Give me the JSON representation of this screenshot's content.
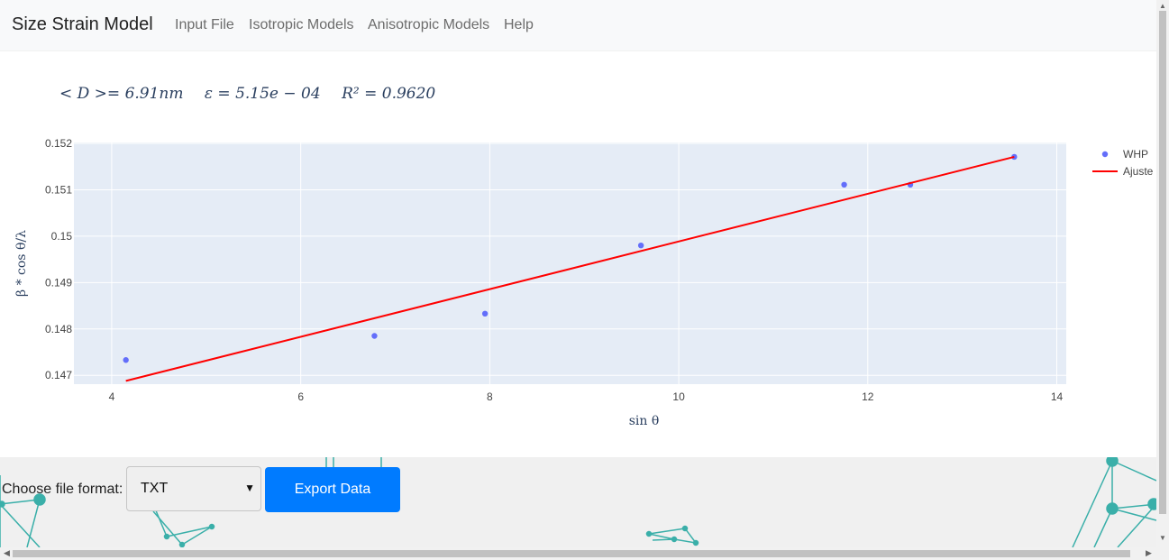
{
  "navbar": {
    "brand": "Size Strain Model",
    "links": [
      "Input File",
      "Isotropic Models",
      "Anisotropic Models",
      "Help"
    ]
  },
  "equation": {
    "size": "< D >= 6.91nm",
    "strain": "ε = 5.15e − 04",
    "r2": "R² = 0.9620"
  },
  "chart_data": {
    "type": "scatter",
    "xlabel": "sin θ",
    "ylabel": "β * cos θ/λ",
    "xlim": [
      3.6,
      14.1
    ],
    "ylim": [
      0.14681,
      0.15202
    ],
    "x_ticks": [
      4,
      6,
      8,
      10,
      12,
      14
    ],
    "y_ticks": [
      0.147,
      0.148,
      0.149,
      0.15,
      0.151,
      0.152
    ],
    "grid": true,
    "legend_position": "top-right",
    "series": [
      {
        "name": "WHP",
        "mode": "markers",
        "color": "#636efa",
        "x": [
          4.15,
          6.78,
          7.95,
          9.6,
          11.75,
          12.45,
          13.55
        ],
        "y": [
          0.14733,
          0.14785,
          0.14833,
          0.1498,
          0.15111,
          0.15111,
          0.15171
        ]
      },
      {
        "name": "Ajuste",
        "mode": "lines",
        "color": "#ff0000",
        "x": [
          4.15,
          13.55
        ],
        "y": [
          0.14688,
          0.15171
        ]
      }
    ]
  },
  "export": {
    "label": "Choose file format:",
    "selected_format": "TXT",
    "button_label": "Export Data"
  },
  "colors": {
    "accent": "#007bff",
    "plot_bg": "#e5ecf6",
    "network": "#3aafa9"
  }
}
